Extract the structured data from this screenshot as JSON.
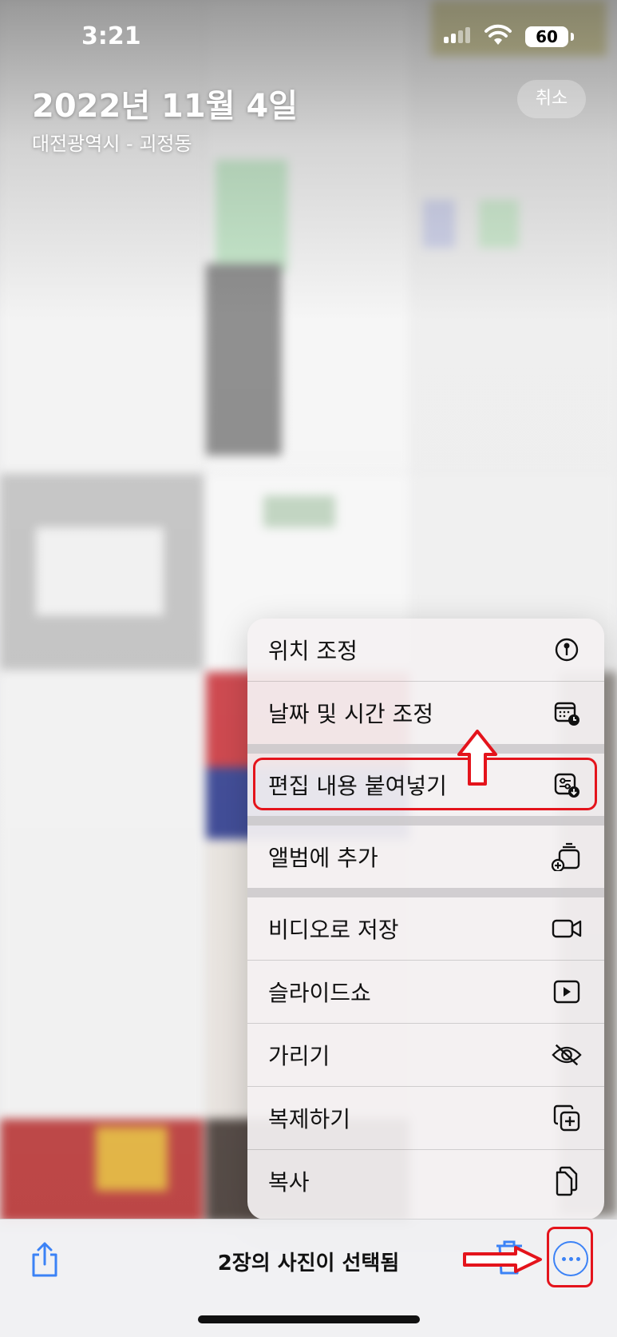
{
  "status_bar": {
    "time": "3:21",
    "battery": "60"
  },
  "header": {
    "date": "2022년 11월 4일",
    "location": "대전광역시 - 괴정동",
    "cancel_label": "취소"
  },
  "menu": {
    "items": [
      {
        "label": "위치 조정",
        "icon": "location-pin-icon"
      },
      {
        "label": "날짜 및 시간 조정",
        "icon": "calendar-clock-icon"
      },
      {
        "label": "편집 내용 붙여넣기",
        "icon": "paste-edits-icon",
        "highlighted": true
      },
      {
        "label": "앨범에 추가",
        "icon": "add-to-album-icon"
      },
      {
        "label": "비디오로 저장",
        "icon": "video-camera-icon"
      },
      {
        "label": "슬라이드쇼",
        "icon": "play-icon"
      },
      {
        "label": "가리기",
        "icon": "eye-slash-icon"
      },
      {
        "label": "복제하기",
        "icon": "duplicate-icon"
      },
      {
        "label": "복사",
        "icon": "copy-icon"
      }
    ]
  },
  "bottom_bar": {
    "selection_text": "2장의 사진이 선택됨"
  },
  "colors": {
    "accent": "#3b82f6",
    "annotation": "#e4141c"
  }
}
